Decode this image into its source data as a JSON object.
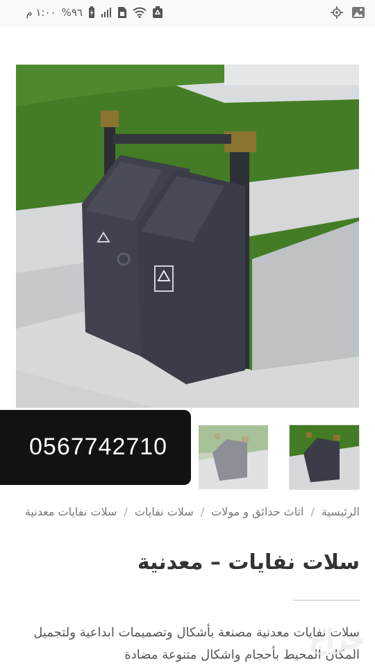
{
  "status_bar": {
    "time": "١:٠٠ م",
    "battery_percent": "%٩٦",
    "left_icons": [
      "battery-charging-icon",
      "signal-icon",
      "sim-icon",
      "wifi-icon",
      "recycle-notification-icon"
    ],
    "right_icons": [
      "location-icon",
      "gallery-icon"
    ]
  },
  "product": {
    "phone_number": "0567742710",
    "breadcrumb": [
      "الرئيسية",
      "اثاث حدائق و مولات",
      "سلات نفايات",
      "سلات نفايات معدنية"
    ],
    "title": "سلات نفايات – معدنية",
    "description": "سلات نفايات معدنية مصنعة بأشكال وتصميمات ابداعية ولتجميل المكان المحيط بأحجام واشكال متنوعة مضادة",
    "watermark": "حراج"
  },
  "colors": {
    "overlay_bg": "#121212",
    "bin_color": "#3e414b",
    "grass": "#3f7a22"
  }
}
